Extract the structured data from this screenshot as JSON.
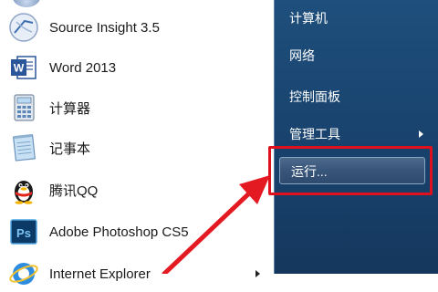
{
  "left_menu": {
    "items": [
      {
        "label": "Source Insight 3.5",
        "icon": "source-insight-icon"
      },
      {
        "label": "Word 2013",
        "icon": "word-icon"
      },
      {
        "label": "计算器",
        "icon": "calculator-icon"
      },
      {
        "label": "记事本",
        "icon": "notepad-icon"
      },
      {
        "label": "腾讯QQ",
        "icon": "qq-penguin-icon"
      },
      {
        "label": "Adobe Photoshop CS5",
        "icon": "photoshop-icon"
      },
      {
        "label": "Internet Explorer",
        "icon": "internet-explorer-icon"
      }
    ]
  },
  "right_menu": {
    "items": [
      {
        "label": "计算机"
      },
      {
        "label": "网络"
      },
      {
        "label": "控制面板"
      },
      {
        "label": "管理工具"
      },
      {
        "label": "运行..."
      }
    ]
  },
  "colors": {
    "highlight": "#e0101c",
    "pane_blue": "#1a4672",
    "arrow_red": "#e41a22"
  }
}
